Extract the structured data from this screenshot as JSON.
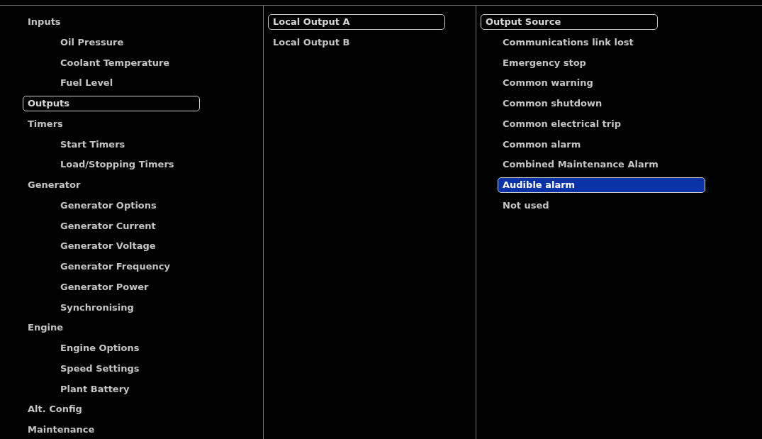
{
  "columns": [
    {
      "items": [
        {
          "label": "Inputs",
          "selected": false,
          "children": [
            {
              "label": "Oil Pressure",
              "selected": false
            },
            {
              "label": "Coolant Temperature",
              "selected": false
            },
            {
              "label": "Fuel Level",
              "selected": false
            }
          ]
        },
        {
          "label": "Outputs",
          "selected": true
        },
        {
          "label": "Timers",
          "selected": false,
          "children": [
            {
              "label": "Start Timers",
              "selected": false
            },
            {
              "label": "Load/Stopping Timers",
              "selected": false
            }
          ]
        },
        {
          "label": "Generator",
          "selected": false,
          "children": [
            {
              "label": "Generator Options",
              "selected": false
            },
            {
              "label": "Generator Current",
              "selected": false
            },
            {
              "label": "Generator Voltage",
              "selected": false
            },
            {
              "label": "Generator Frequency",
              "selected": false
            },
            {
              "label": "Generator Power",
              "selected": false
            },
            {
              "label": "Synchronising",
              "selected": false
            }
          ]
        },
        {
          "label": "Engine",
          "selected": false,
          "children": [
            {
              "label": "Engine Options",
              "selected": false
            },
            {
              "label": "Speed Settings",
              "selected": false
            },
            {
              "label": "Plant Battery",
              "selected": false
            }
          ]
        },
        {
          "label": "Alt. Config",
          "selected": false
        },
        {
          "label": "Maintenance",
          "selected": false
        }
      ]
    },
    {
      "items": [
        {
          "label": "Local Output A",
          "selected": true
        },
        {
          "label": "Local Output B",
          "selected": false
        }
      ]
    },
    {
      "items": [
        {
          "label": "Output Source",
          "selected": true,
          "children": [
            {
              "label": "Communications link lost",
              "selected": false,
              "highlighted": false
            },
            {
              "label": "Emergency stop",
              "selected": false,
              "highlighted": false
            },
            {
              "label": "Common warning",
              "selected": false,
              "highlighted": false
            },
            {
              "label": "Common shutdown",
              "selected": false,
              "highlighted": false
            },
            {
              "label": "Common electrical trip",
              "selected": false,
              "highlighted": false
            },
            {
              "label": "Common alarm",
              "selected": false,
              "highlighted": false
            },
            {
              "label": "Combined Maintenance Alarm",
              "selected": false,
              "highlighted": false
            },
            {
              "label": "Audible alarm",
              "selected": true,
              "highlighted": true
            },
            {
              "label": "Not used",
              "selected": false,
              "highlighted": false
            }
          ]
        }
      ]
    }
  ]
}
